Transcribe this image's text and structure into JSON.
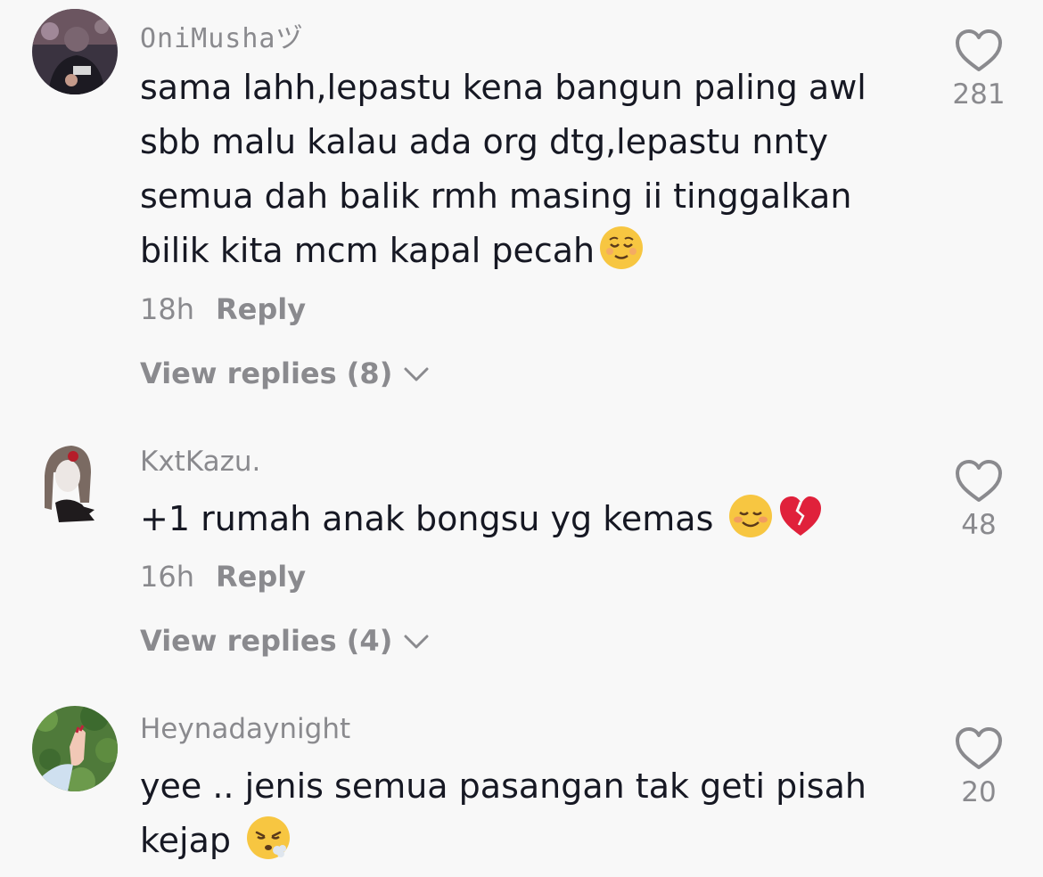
{
  "comments": [
    {
      "username": "OniMushaヅ",
      "text": "sama lahh,lepastu kena bangun paling awl sbb malu kalau ada org dtg,lepastu nnty semua dah balik rmh masing ii tinggalkan bilik kita mcm kapal pecah",
      "emoji": [
        "relieved-face-emoji"
      ],
      "time": "18h",
      "reply_label": "Reply",
      "view_replies": "View replies (8)",
      "likes": "281"
    },
    {
      "username": "KxtKazu.",
      "text": "+1 rumah anak bongsu yg kemas ",
      "emoji": [
        "smiling-face-emoji",
        "broken-heart-emoji"
      ],
      "time": "16h",
      "reply_label": "Reply",
      "view_replies": "View replies (4)",
      "likes": "48"
    },
    {
      "username": "Heynadaynight",
      "text": "yee .. jenis semua pasangan tak geti pisah kejap ",
      "emoji": [
        "face-exhaling-emoji"
      ],
      "likes": "20"
    }
  ],
  "icons": {
    "like": "heart-outline-icon",
    "expand": "chevron-down-icon"
  },
  "colors": {
    "background": "#f8f8f8",
    "text": "#161823",
    "secondary": "#8a8a8e"
  }
}
